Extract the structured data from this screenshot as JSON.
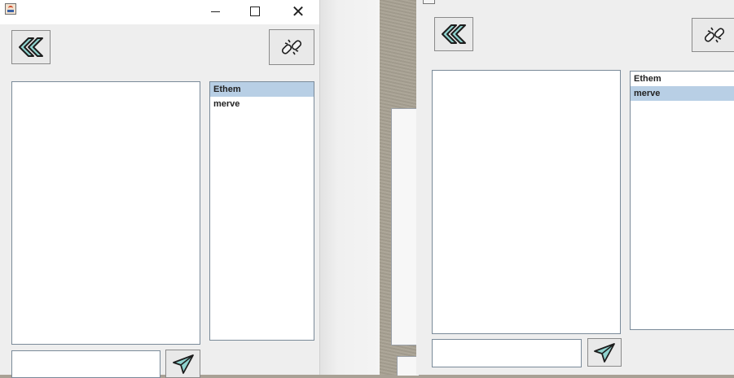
{
  "windows": [
    {
      "id": "left",
      "titlebar": {
        "minimize_icon": "minimize-icon",
        "maximize_icon": "maximize-icon",
        "close_glyph": "✕"
      },
      "users": [
        {
          "name": "Ethem",
          "selected": true
        },
        {
          "name": "merve",
          "selected": false
        }
      ],
      "message_value": ""
    },
    {
      "id": "right",
      "users": [
        {
          "name": "Ethem",
          "selected": false
        },
        {
          "name": "merve",
          "selected": true
        }
      ],
      "message_value": ""
    }
  ],
  "icons": {
    "back": "double-chevron-left-icon",
    "disconnect": "broken-link-icon",
    "send": "paper-plane-icon"
  },
  "colors": {
    "accent_teal": "#8fd3cf",
    "selection": "#b8cfe5"
  }
}
